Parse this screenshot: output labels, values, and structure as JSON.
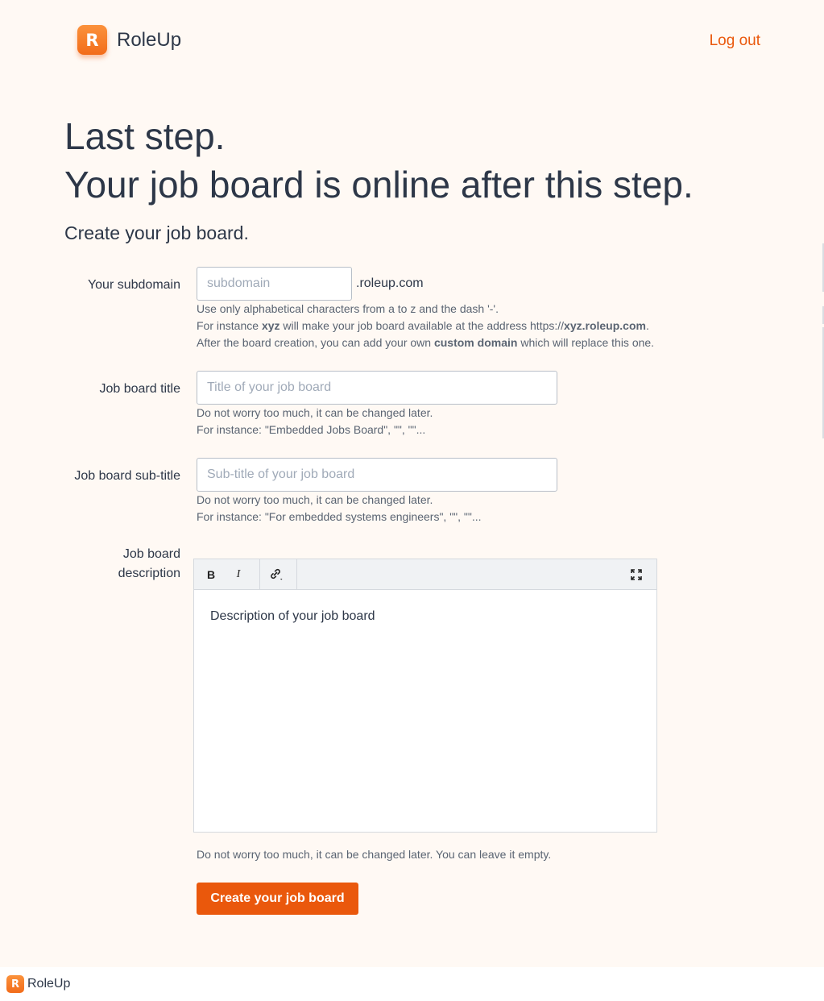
{
  "header": {
    "logo_letter": "R",
    "logo_text": "RoleUp",
    "logout_label": "Log out"
  },
  "intro": {
    "line1": "Last step.",
    "line2": "Your job board is online after this step.",
    "subhead": "Create your job board."
  },
  "form": {
    "subdomain": {
      "label": "Your subdomain",
      "placeholder": "subdomain",
      "value": "",
      "suffix": ".roleup.com",
      "help_line1": "Use only alphabetical characters from a to z and the dash '-'.",
      "help_line2_pre": "For instance ",
      "help_line2_bold1": "xyz",
      "help_line2_mid": " will make your job board available at the address https://",
      "help_line2_bold2": "xyz.roleup.com",
      "help_line2_end": ".",
      "help_line3_pre": "After the board creation, you can add your own ",
      "help_line3_bold": "custom domain",
      "help_line3_end": " which will replace this one."
    },
    "title": {
      "label": "Job board title",
      "placeholder": "Title of your job board",
      "value": "",
      "help_line1": "Do not worry too much, it can be changed later.",
      "help_line2": "For instance: \"Embedded Jobs Board\", \"\", \"\"..."
    },
    "subtitle": {
      "label": "Job board sub-title",
      "placeholder": "Sub-title of your job board",
      "value": "",
      "help_line1": "Do not worry too much, it can be changed later.",
      "help_line2": "For instance: \"For embedded systems engineers\", \"\", \"\"..."
    },
    "description": {
      "label_line1": "Job board",
      "label_line2": "description",
      "toolbar_bold": "B",
      "toolbar_italic": "I",
      "content": "Description of your job board",
      "help": "Do not worry too much, it can be changed later. You can leave it empty."
    },
    "submit_label": "Create your job board"
  },
  "footer": {
    "logo_letter": "R",
    "logo_text": "RoleUp"
  },
  "colors": {
    "brand": "#ea580c",
    "background": "#fff9f4",
    "text": "#2d3748"
  }
}
